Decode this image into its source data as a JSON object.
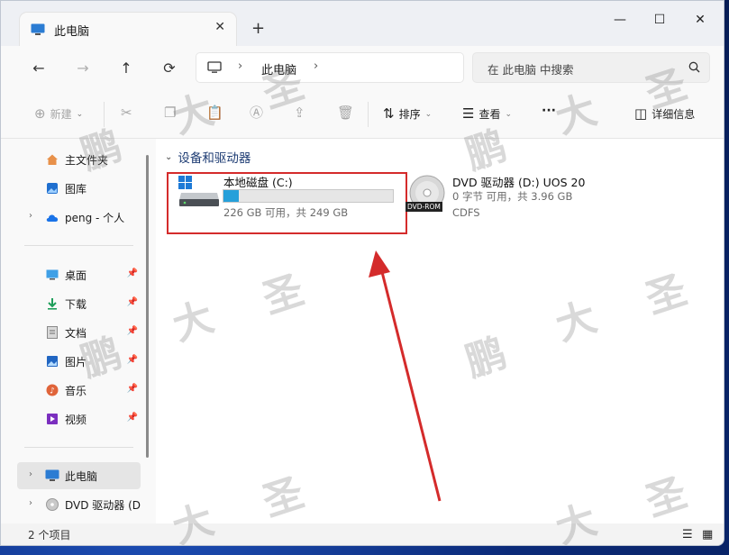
{
  "tab": {
    "title": "此电脑",
    "close": "✕",
    "new_tab": "+"
  },
  "window_controls": {
    "minimize": "—",
    "maximize": "☐",
    "close": "✕"
  },
  "nav": {
    "back": "←",
    "forward": "→",
    "up": "↑",
    "refresh": "⟳",
    "breadcrumb": [
      "此电脑"
    ],
    "sep": "›",
    "search_placeholder": "在 此电脑 中搜索"
  },
  "commands": {
    "new_label": "新建",
    "sort_label": "排序",
    "view_label": "查看",
    "more_label": "···",
    "details_label": "详细信息"
  },
  "sidebar": {
    "items": [
      {
        "label": "主文件夹",
        "icon": "home-icon"
      },
      {
        "label": "图库",
        "icon": "gallery-icon"
      },
      {
        "label": "peng - 个人",
        "icon": "cloud-icon"
      },
      {
        "label": "桌面",
        "icon": "desktop-icon"
      },
      {
        "label": "下载",
        "icon": "download-icon"
      },
      {
        "label": "文档",
        "icon": "document-icon"
      },
      {
        "label": "图片",
        "icon": "pictures-icon"
      },
      {
        "label": "音乐",
        "icon": "music-icon"
      },
      {
        "label": "视频",
        "icon": "video-icon"
      },
      {
        "label": "此电脑",
        "icon": "computer-icon"
      },
      {
        "label": "DVD 驱动器 (D",
        "icon": "dvd-icon"
      }
    ]
  },
  "main": {
    "group_label": "设备和驱动器",
    "drives": [
      {
        "name": "本地磁盘 (C:)",
        "info": "226 GB 可用，共 249 GB",
        "used_fraction": 0.093
      },
      {
        "name": "DVD 驱动器 (D:) UOS 20",
        "info": "0 字节 可用，共 3.96 GB",
        "fs": "CDFS",
        "badge": "DVD-ROM"
      }
    ]
  },
  "status": {
    "count": "2 个项目"
  },
  "watermark": {
    "chars": [
      "大",
      "圣",
      "鹏"
    ]
  },
  "colors": {
    "accent": "#26a0da",
    "highlight_box": "#d42b2b",
    "arrow": "#d42b2b"
  }
}
